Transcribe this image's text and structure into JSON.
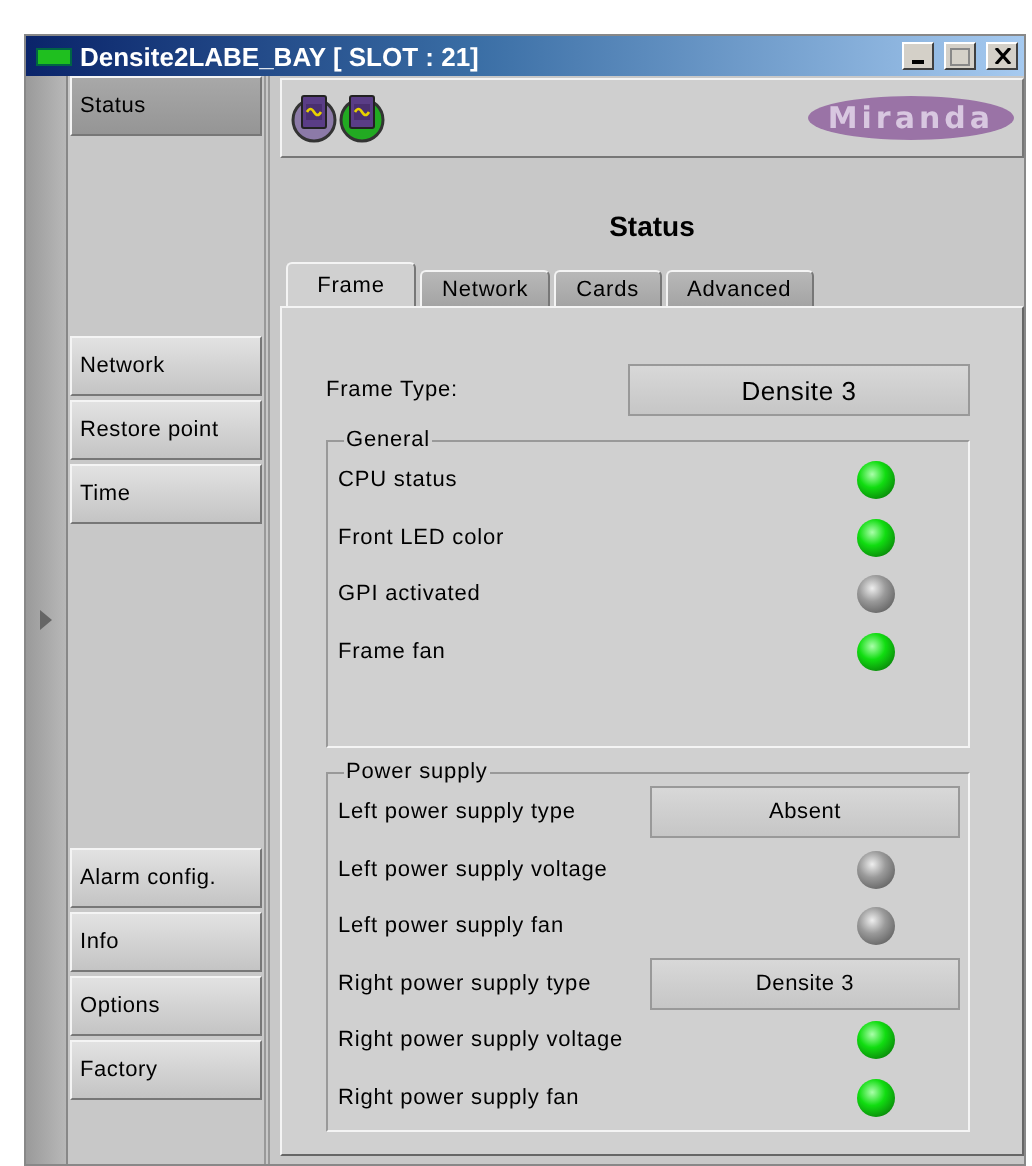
{
  "window": {
    "title": "Densite2LABE_BAY [ SLOT : 21]"
  },
  "header": {
    "logo": "Miranda",
    "icons": [
      {
        "on": false
      },
      {
        "on": true
      }
    ]
  },
  "sidebar": {
    "sections": [
      {
        "items": [
          {
            "label": "Status",
            "selected": true
          }
        ]
      },
      {
        "items": [
          {
            "label": "Network",
            "selected": false
          },
          {
            "label": "Restore point",
            "selected": false
          },
          {
            "label": "Time",
            "selected": false
          }
        ]
      },
      {
        "items": [
          {
            "label": "Alarm config.",
            "selected": false
          },
          {
            "label": "Info",
            "selected": false
          },
          {
            "label": "Options",
            "selected": false
          },
          {
            "label": "Factory",
            "selected": false
          }
        ]
      }
    ]
  },
  "page_title": "Status",
  "tabs": [
    {
      "label": "Frame",
      "selected": true
    },
    {
      "label": "Network",
      "selected": false
    },
    {
      "label": "Cards",
      "selected": false
    },
    {
      "label": "Advanced",
      "selected": false
    }
  ],
  "frame_type": {
    "label": "Frame Type:",
    "value": "Densite 3"
  },
  "groups": [
    {
      "title": "General",
      "rows": [
        {
          "kind": "led",
          "label": "CPU status",
          "on": true
        },
        {
          "kind": "led",
          "label": "Front LED color",
          "on": true
        },
        {
          "kind": "led",
          "label": "GPI activated",
          "on": false
        },
        {
          "kind": "led",
          "label": "Frame fan",
          "on": true
        }
      ]
    },
    {
      "title": "Power supply",
      "rows": [
        {
          "kind": "value",
          "label": "Left power supply type",
          "value": "Absent"
        },
        {
          "kind": "led",
          "label": "Left power supply voltage",
          "on": false
        },
        {
          "kind": "led",
          "label": "Left power supply fan",
          "on": false
        },
        {
          "kind": "value",
          "label": "Right power supply type",
          "value": "Densite 3"
        },
        {
          "kind": "led",
          "label": "Right power supply voltage",
          "on": true
        },
        {
          "kind": "led",
          "label": "Right power supply fan",
          "on": true
        }
      ]
    }
  ]
}
